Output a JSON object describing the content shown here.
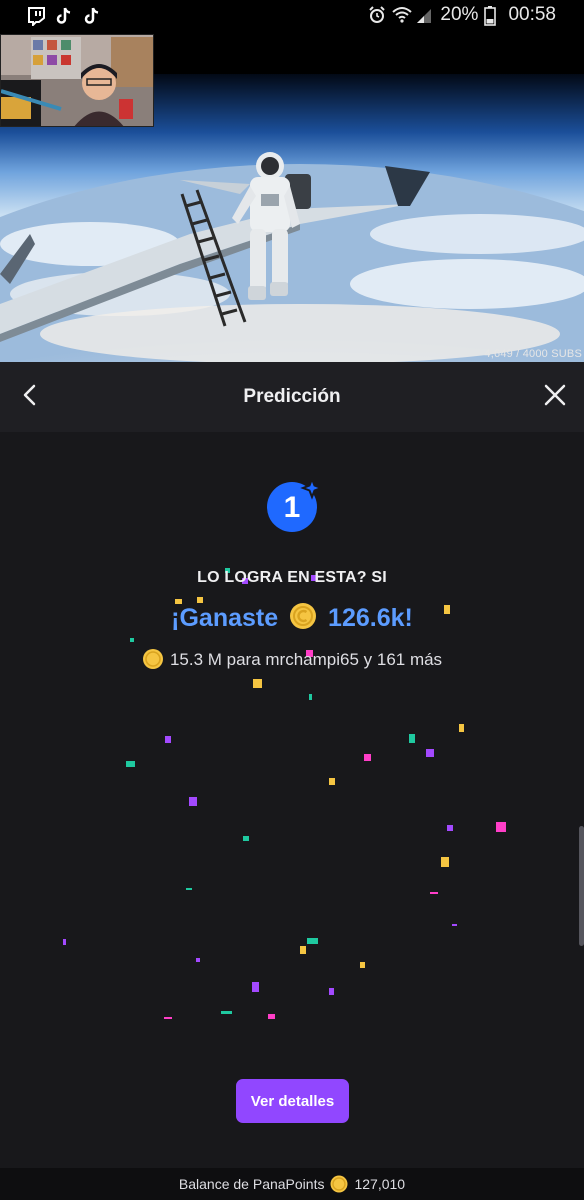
{
  "status_bar": {
    "battery": "20%",
    "time": "00:58",
    "apps": [
      "twitch-icon",
      "tiktok-icon",
      "tiktok-icon"
    ]
  },
  "video": {
    "subs_counter": "4,649 / 4000 SUBS"
  },
  "prediction": {
    "title": "Predicción",
    "badge_number": "1",
    "outcome": "LO LOGRA EN ESTA? SI",
    "won_prefix": "¡Ganaste",
    "won_amount": "126.6k!",
    "winners_text": "15.3 M para mrchampi65 y 161 más",
    "details_button": "Ver detalles"
  },
  "balance": {
    "label": "Balance de PanaPoints",
    "value": "127,010"
  },
  "colors": {
    "accent": "#9147ff",
    "win_blue": "#5c9cff",
    "badge_blue": "#1f69ff",
    "coin_gold": "#f5c542",
    "panel_bg": "#18181b"
  }
}
